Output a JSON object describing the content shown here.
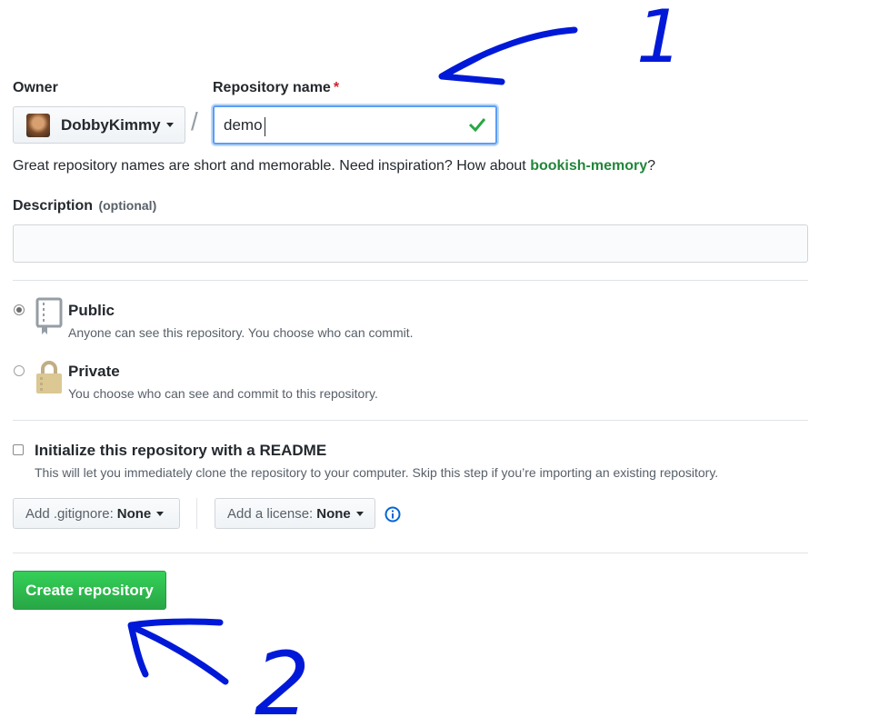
{
  "owner": {
    "label": "Owner",
    "username": "DobbyKimmy"
  },
  "separator": "/",
  "repo": {
    "label": "Repository name",
    "required_mark": "*",
    "value": "demo"
  },
  "hint": {
    "prefix": "Great repository names are short and memorable. Need inspiration? How about ",
    "suggestion": "bookish-memory",
    "suffix": "?"
  },
  "description": {
    "label": "Description",
    "optional": "(optional)",
    "value": "",
    "placeholder": ""
  },
  "visibility": {
    "public": {
      "title": "Public",
      "desc": "Anyone can see this repository. You choose who can commit.",
      "selected": true
    },
    "private": {
      "title": "Private",
      "desc": "You choose who can see and commit to this repository.",
      "selected": false
    }
  },
  "readme": {
    "title": "Initialize this repository with a README",
    "desc": "This will let you immediately clone the repository to your computer. Skip this step if you’re importing an existing repository.",
    "checked": false
  },
  "gitignore": {
    "label": "Add .gitignore:",
    "value": "None"
  },
  "license": {
    "label": "Add a license:",
    "value": "None"
  },
  "create_button": "Create repository",
  "annotations": {
    "arrow_1_number": "1",
    "arrow_2_number": "2",
    "ink_color": "#0019d8"
  },
  "colors": {
    "primary_green": "#2cbe4e",
    "suggestion_green": "#22863a",
    "valid_check": "#28a745",
    "focus_blue": "#0366d6"
  }
}
